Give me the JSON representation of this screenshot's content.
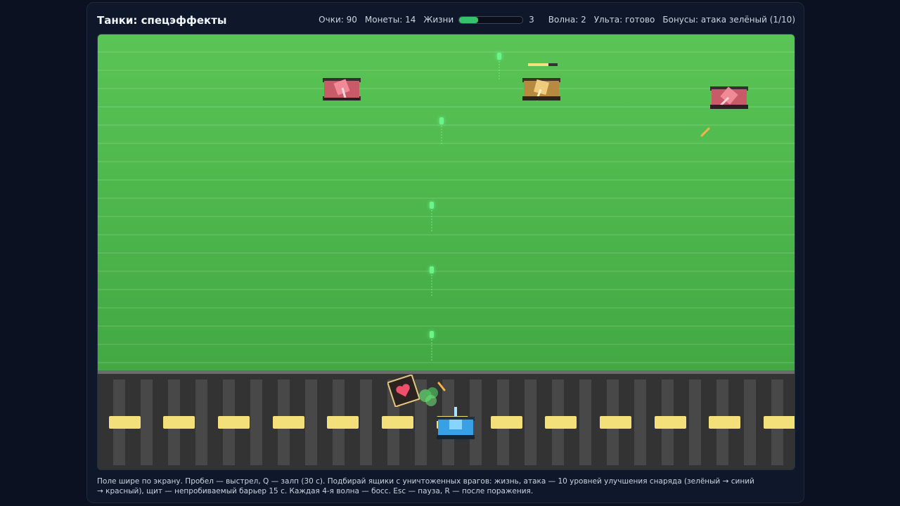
{
  "header": {
    "title": "Танки: спецэффекты"
  },
  "hud": {
    "score": "Очки: 90",
    "coins": "Монеты: 14",
    "lives_label": "Жизни",
    "lives_value": "3",
    "lives_fraction": 0.3,
    "wave": "Волна: 2",
    "ult": "Ульта: готово",
    "bonuses": "Бонусы: атака зелёный (1/10)"
  },
  "entities": {
    "player_color": "#3aa0e6",
    "enemy_color": "#e26677",
    "miniboss_color": "#e0b45a",
    "bullet_color": "#69f58a",
    "crate_icon": "heart-crate-icon"
  },
  "footer": {
    "help_text": "Поле шире по экрану. Пробел — выстрел, Q — залп (30 с). Подбирай ящики с уничтоженных врагов: жизнь, атака — 10 уровней улучшения снаряда (зелёный → синий → красный), щит — непробиваемый барьер 15 с. Каждая 4-я волна — босс. Esc — пауза, R — после поражения."
  }
}
